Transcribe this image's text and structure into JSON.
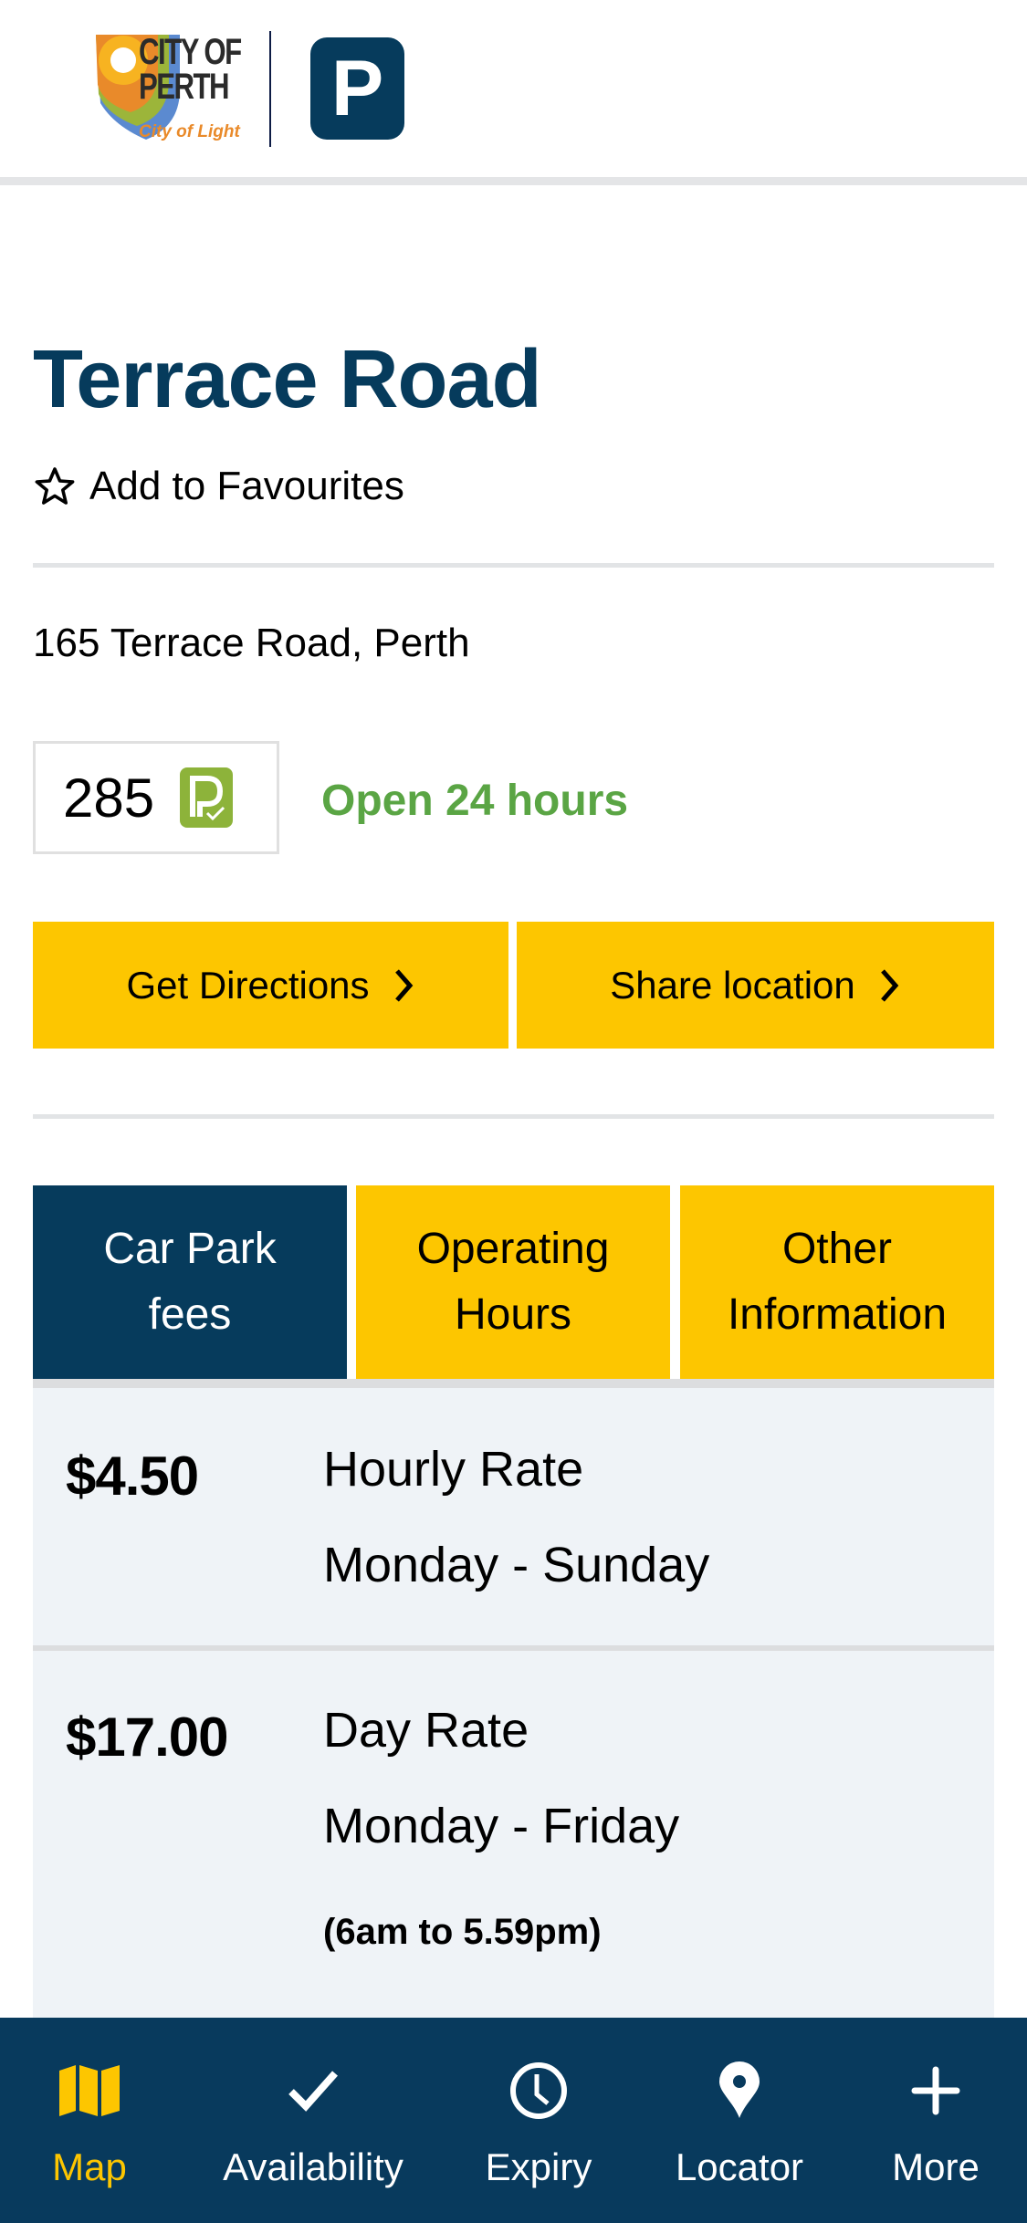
{
  "header": {
    "logo_line1": "CITY OF",
    "logo_line2": "PERTH",
    "logo_tagline": "City of Light",
    "parking_badge": "P"
  },
  "carpark": {
    "name": "Terrace Road",
    "favourite_label": "Add to Favourites",
    "address": "165 Terrace Road, Perth",
    "available_bays": "285",
    "open_status": "Open 24 hours"
  },
  "actions": {
    "directions_label": "Get Directions",
    "share_label": "Share location"
  },
  "tabs": [
    {
      "line1": "Car Park",
      "line2": "fees",
      "active": true
    },
    {
      "line1": "Operating",
      "line2": "Hours",
      "active": false
    },
    {
      "line1": "Other",
      "line2": "Information",
      "active": false
    }
  ],
  "fees": [
    {
      "price": "$4.50",
      "rate": "Hourly Rate",
      "days": "Monday - Sunday",
      "note": ""
    },
    {
      "price": "$17.00",
      "rate": "Day Rate",
      "days": "Monday - Friday",
      "note": "(6am to 5.59pm)"
    }
  ],
  "nav": {
    "items": [
      {
        "label": "Map",
        "icon": "map-icon",
        "active": true
      },
      {
        "label": "Availability",
        "icon": "check-icon",
        "active": false
      },
      {
        "label": "Expiry",
        "icon": "clock-icon",
        "active": false
      },
      {
        "label": "Locator",
        "icon": "location-pin-icon",
        "active": false
      },
      {
        "label": "More",
        "icon": "plus-icon",
        "active": false
      }
    ]
  },
  "colors": {
    "brand_navy": "#063b5c",
    "accent_yellow": "#fdc600",
    "open_green": "#5aa544",
    "availability_green": "#8db33a",
    "fee_background": "#eff3f7"
  }
}
